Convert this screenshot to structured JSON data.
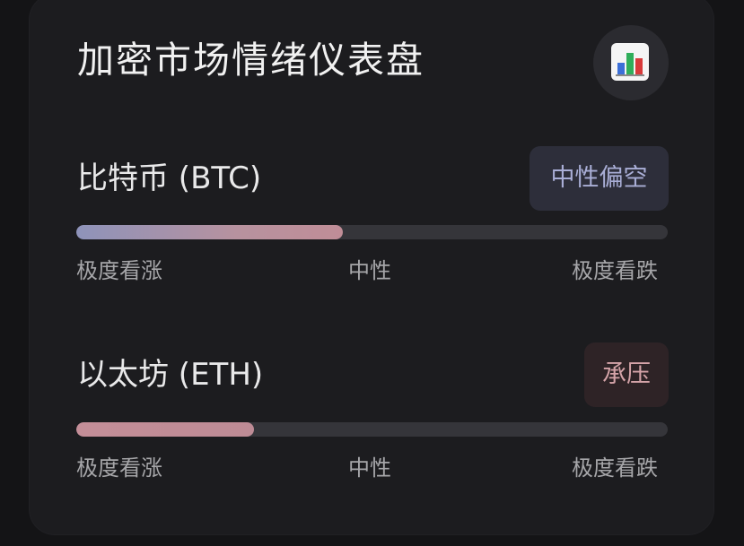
{
  "dashboard": {
    "title": "加密市场情绪仪表盘",
    "chart_icon": "bar-chart-icon"
  },
  "assets": [
    {
      "name": "比特币 (BTC)",
      "sentiment": "中性偏空",
      "sentiment_color": "#a9aed6",
      "level": 0.45,
      "scale": [
        "极度看涨",
        "中性",
        "极度看跌"
      ]
    },
    {
      "name": "以太坊 (ETH)",
      "sentiment": "承压",
      "sentiment_color": "#d4a3a8",
      "level": 0.3,
      "scale": [
        "极度看涨",
        "中性",
        "极度看跌"
      ]
    }
  ],
  "colors": {
    "background": "#141416",
    "card": "#1c1c1f",
    "track": "#35353a",
    "btc_fill_start": "#8e93ba",
    "btc_fill_end": "#c08d97",
    "eth_fill": "#c48e98"
  }
}
